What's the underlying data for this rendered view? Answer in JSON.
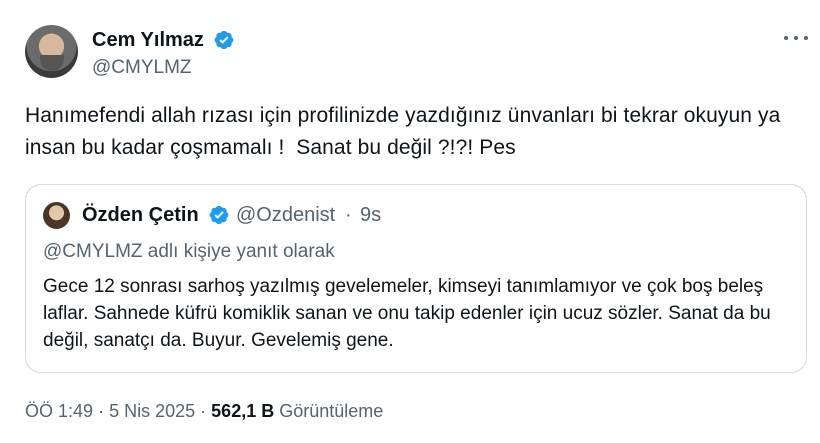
{
  "author": {
    "name": "Cem Yılmaz",
    "handle": "@CMYLMZ"
  },
  "tweet": {
    "text": "Hanımefendi allah rızası için profilinizde yazdığınız ünvanları bi tekrar okuyun ya insan bu kadar çoşmamalı !  Sanat bu değil ?!?! Pes"
  },
  "quoted": {
    "name": "Özden Çetin",
    "handle": "@Ozdenist",
    "separator": "·",
    "time": "9s",
    "reply_context": "@CMYLMZ adlı kişiye yanıt olarak",
    "text": "Gece 12 sonrası sarhoş yazılmış gevelemeler, kimseyi tanımlamıyor ve çok boş beleş laflar. Sahnede küfrü komiklik sanan ve onu takip edenler için ucuz sözler. Sanat da bu değil, sanatçı da. Buyur. Gevelemiş gene."
  },
  "meta": {
    "time": "ÖÖ 1:49",
    "sep1": "·",
    "date": "5 Nis 2025",
    "sep2": "·",
    "views_count": "562,1 B",
    "views_label": "Görüntüleme"
  },
  "colors": {
    "verified_blue": "#1d9bf0",
    "secondary_text": "#536471",
    "border": "#cfd9de"
  },
  "icons": {
    "verified": "verified-badge-icon",
    "more": "more-horizontal-icon"
  }
}
